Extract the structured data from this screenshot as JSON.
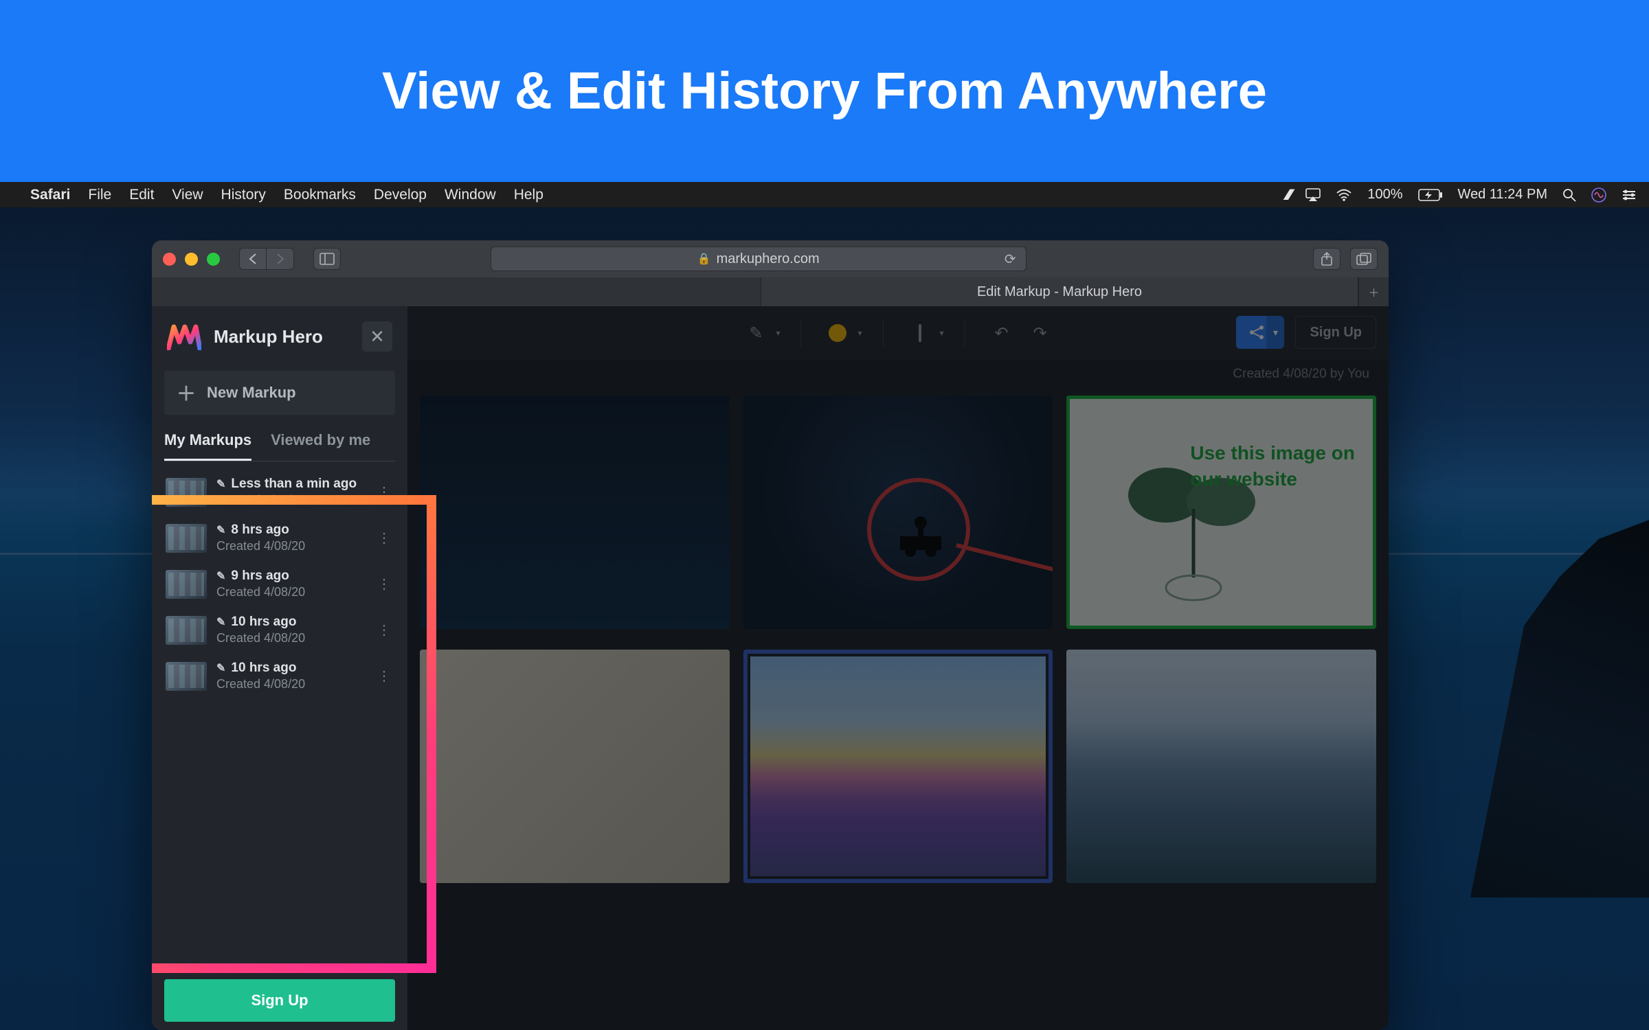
{
  "banner": {
    "title": "View & Edit History From Anywhere"
  },
  "mac_menu": {
    "app": "Safari",
    "items": [
      "File",
      "Edit",
      "View",
      "History",
      "Bookmarks",
      "Develop",
      "Window",
      "Help"
    ],
    "battery": "100%",
    "clock": "Wed 11:24 PM"
  },
  "safari": {
    "url": "markuphero.com",
    "tab_title": "Edit Markup - Markup Hero"
  },
  "sidebar": {
    "logo_text": "Markup Hero",
    "new_markup": "New Markup",
    "tabs": {
      "my": "My Markups",
      "viewed": "Viewed by me"
    },
    "items": [
      {
        "time": "Less than a min ago",
        "created": "Created 4/08/20"
      },
      {
        "time": "8 hrs ago",
        "created": "Created 4/08/20"
      },
      {
        "time": "9 hrs ago",
        "created": "Created 4/08/20"
      },
      {
        "time": "10 hrs ago",
        "created": "Created 4/08/20"
      },
      {
        "time": "10 hrs ago",
        "created": "Created 4/08/20"
      }
    ],
    "signup": "Sign Up"
  },
  "header": {
    "signup": "Sign Up",
    "meta": "Created 4/08/20 by You"
  },
  "annotation": {
    "c3_line1": "Use this image on",
    "c3_line2": "our website"
  }
}
